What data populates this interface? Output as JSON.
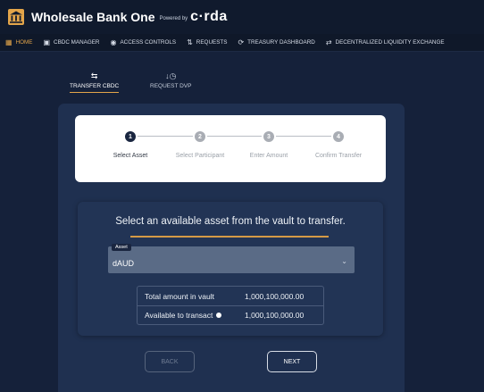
{
  "header": {
    "app_title": "Wholesale Bank One",
    "powered_by": "Powered by",
    "brand": "c·rda",
    "logo_icon": "bank-icon"
  },
  "nav": {
    "active_color": "#e3a54a",
    "items": [
      {
        "label": "HOME",
        "icon": "home-grid-icon",
        "active": true
      },
      {
        "label": "CBDC MANAGER",
        "icon": "card-icon"
      },
      {
        "label": "ACCESS CONTROLS",
        "icon": "globe-icon"
      },
      {
        "label": "REQUESTS",
        "icon": "transfer-arrows-icon"
      },
      {
        "label": "TREASURY DASHBOARD",
        "icon": "refresh-circle-icon"
      },
      {
        "label": "DECENTRALIZED LIQUIDITY EXCHANGE",
        "icon": "exchange-icon"
      }
    ]
  },
  "tabs": [
    {
      "label": "TRANSFER CBDC",
      "icon": "swap-arrows-icon",
      "active": true
    },
    {
      "label": "REQUEST DVP",
      "icon": "request-clock-icon"
    }
  ],
  "stepper": [
    {
      "number": "1",
      "label": "Select Asset",
      "active": true
    },
    {
      "number": "2",
      "label": "Select Participant"
    },
    {
      "number": "3",
      "label": "Enter Amount"
    },
    {
      "number": "4",
      "label": "Confirm Transfer"
    }
  ],
  "content": {
    "prompt": "Select an available asset from the vault to transfer.",
    "asset_field": {
      "legend": "Asset",
      "value": "dAUD"
    },
    "amounts": [
      {
        "label": "Total amount in vault",
        "value": "1,000,100,000.00"
      },
      {
        "label": "Available to transact",
        "value": "1,000,100,000.00",
        "info": true
      }
    ]
  },
  "buttons": {
    "back": "BACK",
    "next": "NEXT"
  }
}
